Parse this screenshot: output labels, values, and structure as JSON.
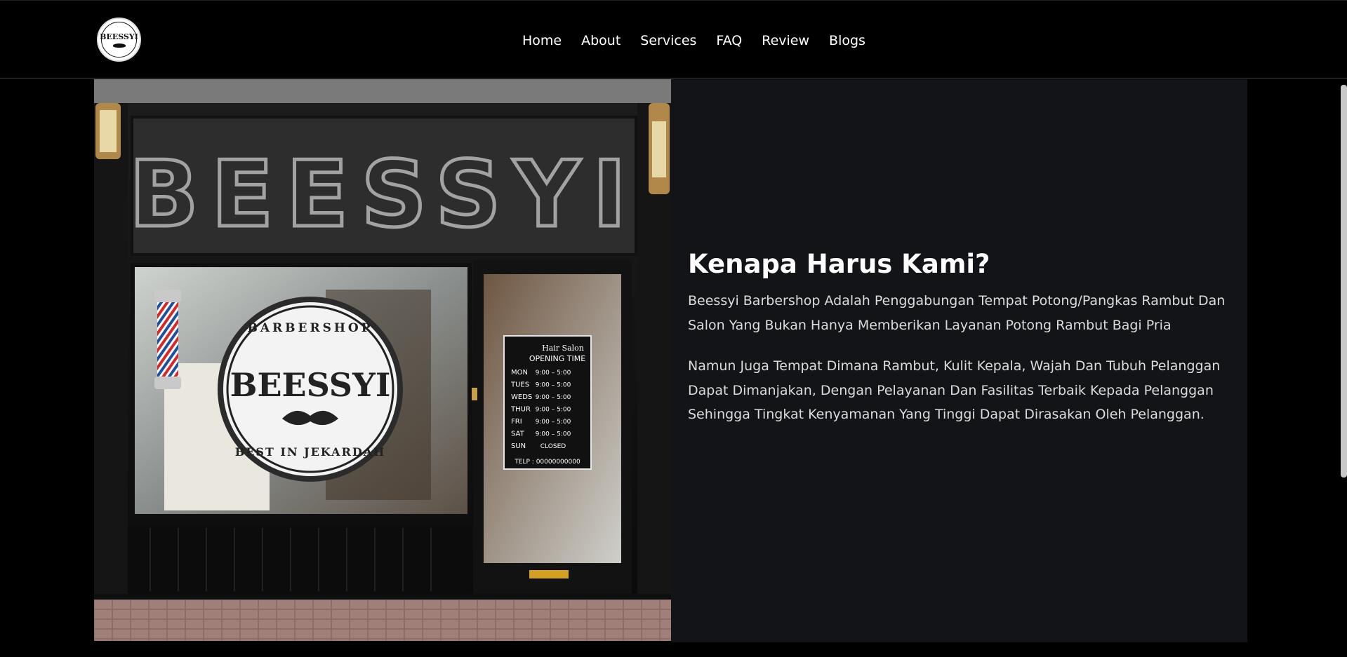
{
  "nav": {
    "logo": {
      "text": "BEESSYI",
      "ring_top": "BARBERSHOP",
      "ring_bottom": "BEST IN JEKARDAH"
    },
    "links": [
      "Home",
      "About",
      "Services",
      "FAQ",
      "Review",
      "Blogs"
    ]
  },
  "storefront": {
    "sign": "BEESSYI",
    "badge": {
      "top": "BARBERSHOP",
      "name": "BEESSYI",
      "bottom": "BEST IN JEKARDAH"
    },
    "hours": {
      "title_small": "Hair Salon",
      "title": "OPENING TIME",
      "rows": [
        {
          "day": "MON",
          "time": "9:00 – 5:00"
        },
        {
          "day": "TUES",
          "time": "9:00 – 5:00"
        },
        {
          "day": "WEDS",
          "time": "9:00 – 5:00"
        },
        {
          "day": "THUR",
          "time": "9:00 – 5:00"
        },
        {
          "day": "FRI",
          "time": "9:00 – 5:00"
        },
        {
          "day": "SAT",
          "time": "9:00 – 5:00"
        },
        {
          "day": "SUN",
          "time": "CLOSED"
        }
      ],
      "telp": "TELP : 00000000000"
    }
  },
  "about": {
    "heading": "Kenapa Harus Kami?",
    "paragraph1": "Beessyi Barbershop Adalah Penggabungan Tempat Potong/Pangkas Rambut Dan Salon Yang Bukan Hanya Memberikan Layanan Potong Rambut Bagi Pria",
    "paragraph2": "Namun Juga Tempat Dimana Rambut, Kulit Kepala, Wajah Dan Tubuh Pelanggan Dapat Dimanjakan, Dengan Pelayanan Dan Fasilitas Terbaik Kepada Pelanggan Sehingga Tingkat Kenyamanan Yang Tinggi Dapat Dirasakan Oleh Pelanggan."
  },
  "colors": {
    "background": "#000000",
    "panel": "#131417",
    "text": "#ffffff",
    "body_text": "#dcdcdc"
  }
}
